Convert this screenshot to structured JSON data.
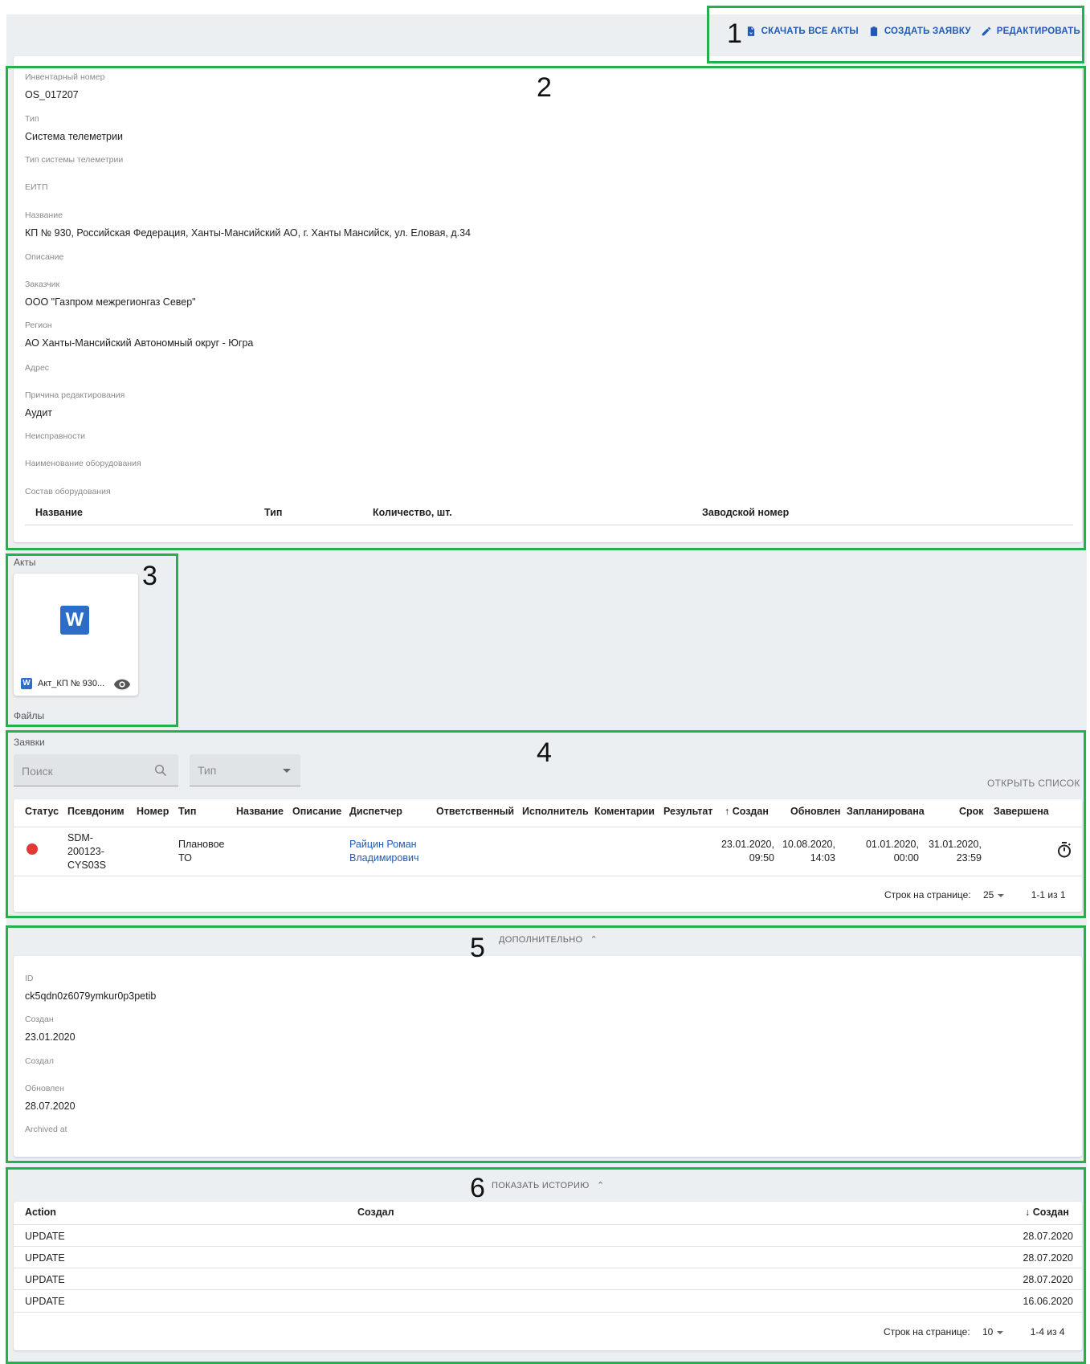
{
  "annotations": [
    "1",
    "2",
    "3",
    "4",
    "5",
    "6"
  ],
  "toolbar": {
    "download_acts": "СКАЧАТЬ ВСЕ АКТЫ",
    "create_request": "СОЗДАТЬ ЗАЯВКУ",
    "edit": "РЕДАКТИРОВАТЬ"
  },
  "info": {
    "inventory_label": "Инвентарный номер",
    "inventory_value": "OS_017207",
    "type_label": "Тип",
    "type_value": "Система телеметрии",
    "telemetry_type_label": "Тип системы телеметрии",
    "eitp_label": "ЕИТП",
    "name_label": "Название",
    "name_value": "КП № 930, Российская Федерация, Ханты-Мансийский АО, г. Ханты Мансийск, ул. Еловая, д.34",
    "description_label": "Описание",
    "customer_label": "Заказчик",
    "customer_value": "ООО \"Газпром межрегионгаз Север\"",
    "region_label": "Регион",
    "region_value": "АО Ханты-Мансийский Автономный округ - Югра",
    "address_label": "Адрес",
    "edit_reason_label": "Причина редактирования",
    "edit_reason_value": "Аудит",
    "faults_label": "Неисправности",
    "equipment_name_label": "Наименование оборудования",
    "equipment_composition_label": "Состав оборудования",
    "equipment_columns": [
      "Название",
      "Тип",
      "Количество, шт.",
      "Заводской номер"
    ]
  },
  "acts": {
    "title": "Акты",
    "file_name": "Акт_КП № 930...",
    "icon_letter": "W"
  },
  "files": {
    "title": "Файлы"
  },
  "requests": {
    "title": "Заявки",
    "search_placeholder": "Поиск",
    "type_placeholder": "Тип",
    "open_list": "ОТКРЫТЬ СПИСОК",
    "columns": [
      "Статус",
      "Псевдоним",
      "Номер",
      "Тип",
      "Название",
      "Описание",
      "Диспетчер",
      "Ответственный",
      "Исполнитель",
      "Коментарии",
      "Результат",
      "↑ Создан",
      "Обновлен",
      "Запланирована",
      "Срок",
      "Завершена"
    ],
    "row": {
      "alias": "SDM-\n200123-\nCYS03S",
      "type": "Плановое\nТО",
      "dispatcher": "Райцин Роман\nВладимирович",
      "created": "23.01.2020,\n09:50",
      "updated": "10.08.2020,\n14:03",
      "planned": "01.01.2020,\n00:00",
      "deadline": "31.01.2020,\n23:59",
      "status_color": "#e53935"
    },
    "rows_per_page_label": "Строк на странице:",
    "rows_per_page": "25",
    "range": "1-1 из 1"
  },
  "additional": {
    "toggle": "ДОПОЛНИТЕЛЬНО",
    "id_label": "ID",
    "id_value": "ck5qdn0z6079ymkur0p3petib",
    "created_label": "Создан",
    "created_value": "23.01.2020",
    "created_by_label": "Создал",
    "updated_label": "Обновлен",
    "updated_value": "28.07.2020",
    "archived_label": "Archived at"
  },
  "history": {
    "toggle": "ПОКАЗАТЬ ИСТОРИЮ",
    "columns": [
      "Action",
      "Создал",
      "↓ Создан"
    ],
    "rows": [
      {
        "action": "UPDATE",
        "date": "28.07.2020"
      },
      {
        "action": "UPDATE",
        "date": "28.07.2020"
      },
      {
        "action": "UPDATE",
        "date": "28.07.2020"
      },
      {
        "action": "UPDATE",
        "date": "16.06.2020"
      }
    ],
    "rows_per_page_label": "Строк на странице:",
    "rows_per_page": "10",
    "range": "1-4 из 4"
  },
  "colors": {
    "accent": "#1e5bb8",
    "annotation": "#22b14c",
    "background": "#eceff1"
  }
}
